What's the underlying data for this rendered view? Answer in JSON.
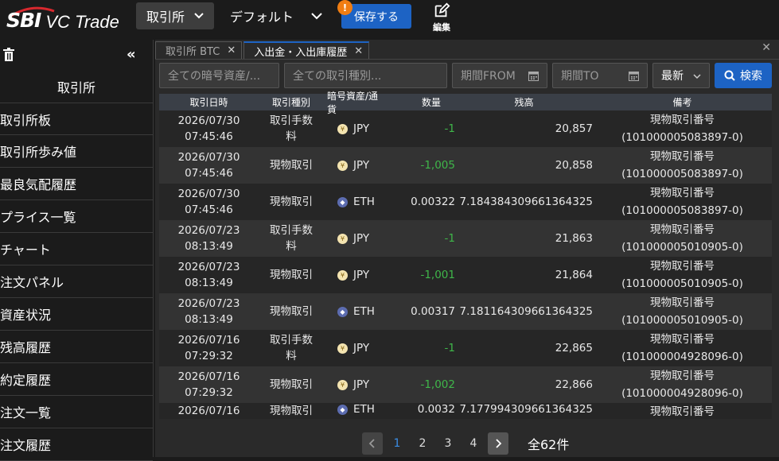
{
  "header": {
    "logo_brand": "SBI",
    "logo_product": "VC Trade",
    "dropdown1": "取引所",
    "dropdown2": "デフォルト",
    "save_label": "保存する",
    "badge": "!",
    "edit_label": "編集"
  },
  "sidebar": {
    "title": "取引所",
    "items": [
      {
        "label": "取引所板"
      },
      {
        "label": "取引所歩み値"
      },
      {
        "label": "最良気配履歴"
      },
      {
        "label": "プライス一覧"
      },
      {
        "label": "チャート"
      },
      {
        "label": "注文パネル"
      },
      {
        "label": "資産状況"
      },
      {
        "label": "残高履歴"
      },
      {
        "label": "約定履歴"
      },
      {
        "label": "注文一覧"
      },
      {
        "label": "注文履歴"
      }
    ]
  },
  "tabs": [
    {
      "label": "取引所 BTC",
      "active": false
    },
    {
      "label": "入出金・入出庫履歴",
      "active": true
    }
  ],
  "filters": {
    "asset_placeholder": "全ての暗号資産/...",
    "type_placeholder": "全ての取引種別...",
    "from_placeholder": "期間FROM",
    "to_placeholder": "期間TO",
    "sort_value": "最新",
    "search_label": "検索"
  },
  "table": {
    "headers": [
      "取引日時",
      "取引種別",
      "暗号資産/通貨",
      "数量",
      "残高",
      "備考"
    ],
    "rows": [
      {
        "date": "2026/07/30",
        "time": "07:45:46",
        "type_line1": "取引手数",
        "type_line2": "料",
        "coin": "jpy",
        "currency": "JPY",
        "qty": "-1",
        "qty_green": true,
        "balance": "20,857",
        "note1": "現物取引番号",
        "note2": "(101000005083897-0)"
      },
      {
        "date": "2026/07/30",
        "time": "07:45:46",
        "type_line1": "現物取引",
        "type_line2": "",
        "coin": "jpy",
        "currency": "JPY",
        "qty": "-1,005",
        "qty_green": true,
        "balance": "20,858",
        "note1": "現物取引番号",
        "note2": "(101000005083897-0)"
      },
      {
        "date": "2026/07/30",
        "time": "07:45:46",
        "type_line1": "現物取引",
        "type_line2": "",
        "coin": "eth",
        "currency": "ETH",
        "qty": "0.00322",
        "qty_green": false,
        "balance": "7.184384309661364325",
        "note1": "現物取引番号",
        "note2": "(101000005083897-0)"
      },
      {
        "date": "2026/07/23",
        "time": "08:13:49",
        "type_line1": "取引手数",
        "type_line2": "料",
        "coin": "jpy",
        "currency": "JPY",
        "qty": "-1",
        "qty_green": true,
        "balance": "21,863",
        "note1": "現物取引番号",
        "note2": "(101000005010905-0)"
      },
      {
        "date": "2026/07/23",
        "time": "08:13:49",
        "type_line1": "現物取引",
        "type_line2": "",
        "coin": "jpy",
        "currency": "JPY",
        "qty": "-1,001",
        "qty_green": true,
        "balance": "21,864",
        "note1": "現物取引番号",
        "note2": "(101000005010905-0)"
      },
      {
        "date": "2026/07/23",
        "time": "08:13:49",
        "type_line1": "現物取引",
        "type_line2": "",
        "coin": "eth",
        "currency": "ETH",
        "qty": "0.00317",
        "qty_green": false,
        "balance": "7.181164309661364325",
        "note1": "現物取引番号",
        "note2": "(101000005010905-0)"
      },
      {
        "date": "2026/07/16",
        "time": "07:29:32",
        "type_line1": "取引手数",
        "type_line2": "料",
        "coin": "jpy",
        "currency": "JPY",
        "qty": "-1",
        "qty_green": true,
        "balance": "22,865",
        "note1": "現物取引番号",
        "note2": "(101000004928096-0)"
      },
      {
        "date": "2026/07/16",
        "time": "07:29:32",
        "type_line1": "現物取引",
        "type_line2": "",
        "coin": "jpy",
        "currency": "JPY",
        "qty": "-1,002",
        "qty_green": true,
        "balance": "22,866",
        "note1": "現物取引番号",
        "note2": "(101000004928096-0)"
      },
      {
        "date": "2026/07/16",
        "time": "",
        "type_line1": "現物取引",
        "type_line2": "",
        "coin": "eth",
        "currency": "ETH",
        "qty": "0.0032",
        "qty_green": false,
        "balance": "7.177994309661364325",
        "note1": "現物取引番号",
        "note2": ""
      }
    ]
  },
  "pagination": {
    "pages": [
      "1",
      "2",
      "3",
      "4"
    ],
    "current": "1",
    "total": "全62件"
  },
  "colors": {
    "accent": "#1d63c4",
    "badge": "#f07d12",
    "positive": "#3fb74a"
  }
}
